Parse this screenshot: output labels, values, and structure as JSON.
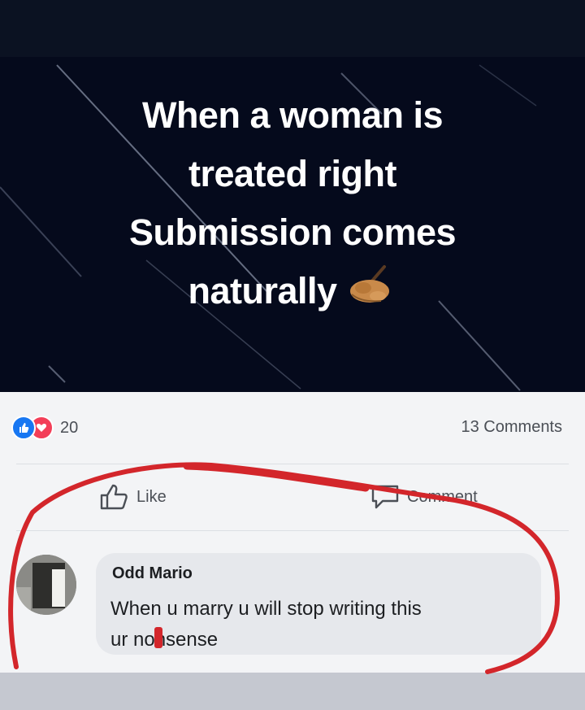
{
  "post": {
    "image_text_lines": [
      "When a woman is",
      "treated right",
      "Submission comes",
      "naturally"
    ],
    "emoji": "writing-hand-emoji"
  },
  "stats": {
    "reaction_count": "20",
    "comments_count": "13 Comments"
  },
  "actions": {
    "like_label": "Like",
    "comment_label": "Comment"
  },
  "comment": {
    "author": "Odd Mario",
    "text_line1": "When u marry u will stop writing this",
    "text_line2": "ur nonsense"
  },
  "colors": {
    "annotation_red": "#d3262b",
    "like_blue": "#1877f2",
    "love_red": "#f33e58"
  }
}
